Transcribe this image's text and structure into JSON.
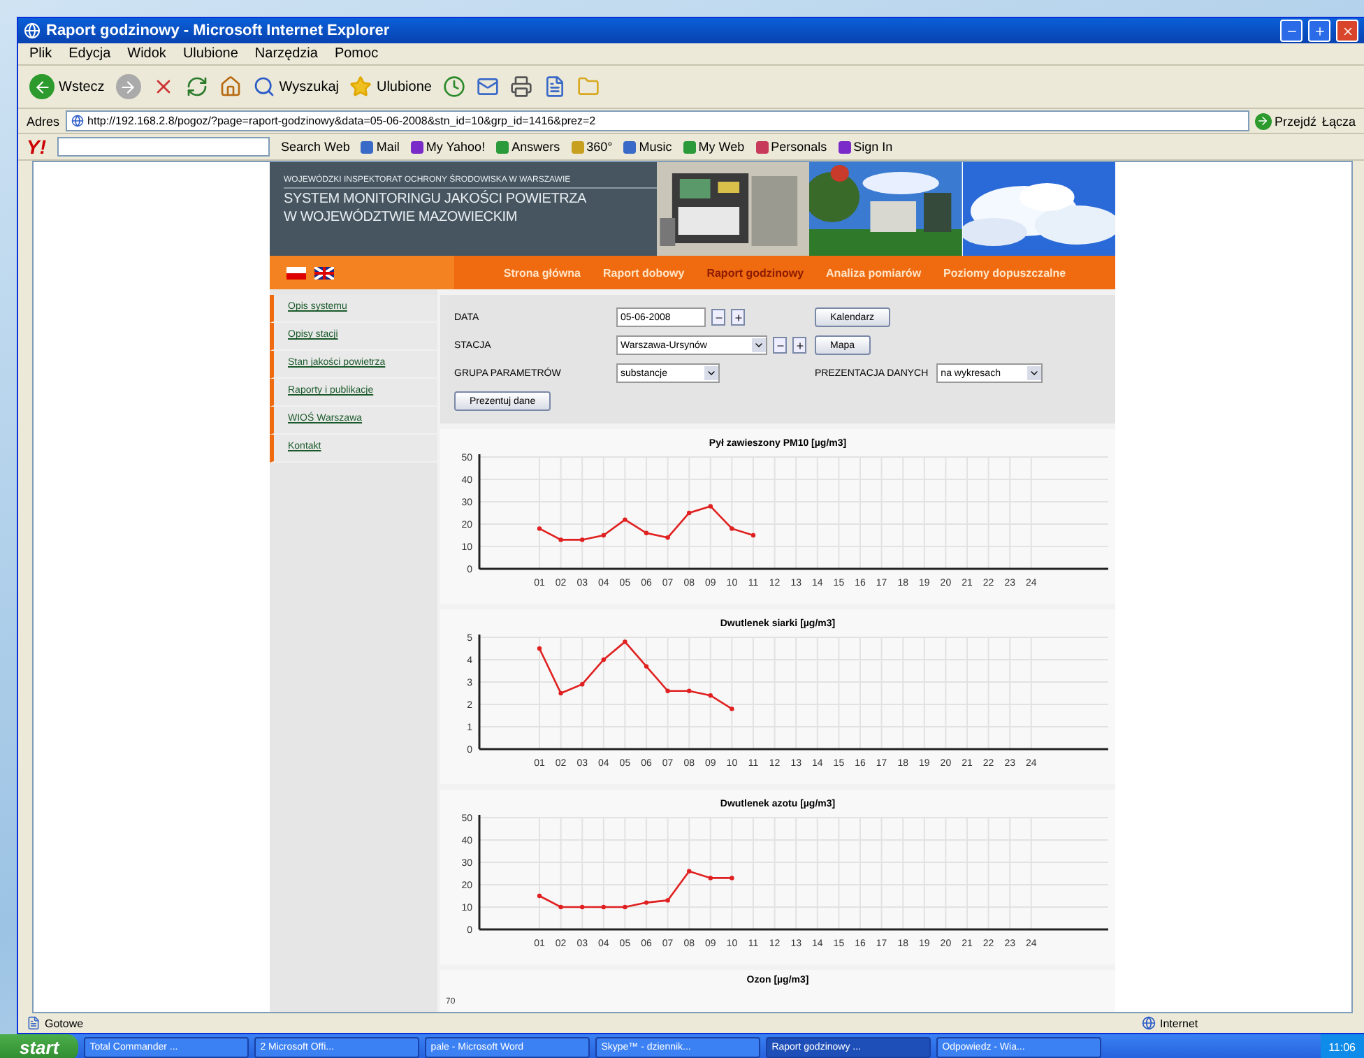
{
  "window": {
    "title": "Raport godzinowy - Microsoft Internet Explorer"
  },
  "menu": [
    "Plik",
    "Edycja",
    "Widok",
    "Ulubione",
    "Narzędzia",
    "Pomoc"
  ],
  "toolbar": {
    "back": "Wstecz",
    "search": "Wyszukaj",
    "favorites": "Ulubione"
  },
  "address_bar": {
    "label": "Adres",
    "url": "http://192.168.2.8/pogoz/?page=raport-godzinowy&data=05-06-2008&stn_id=10&grp_id=1416&prez=2",
    "go": "Przejdź",
    "links": "Łącza"
  },
  "yahoo_bar": {
    "logo": "Y!",
    "search_button": "Search Web",
    "items": [
      "Mail",
      "My Yahoo!",
      "Answers",
      "360°",
      "Music",
      "My Web",
      "Personals",
      "Sign In"
    ]
  },
  "site": {
    "header": {
      "org": "WOJEWÓDZKI INSPEKTORAT OCHRONY ŚRODOWISKA W WARSZAWIE",
      "title_lines": [
        "SYSTEM MONITORINGU JAKOŚCI POWIETRZA",
        "W WOJEWÓDZTWIE MAZOWIECKIM"
      ]
    },
    "nav": [
      {
        "label": "Strona główna",
        "selected": false
      },
      {
        "label": "Raport dobowy",
        "selected": false
      },
      {
        "label": "Raport godzinowy",
        "selected": true
      },
      {
        "label": "Analiza pomiarów",
        "selected": false
      },
      {
        "label": "Poziomy dopuszczalne",
        "selected": false
      }
    ],
    "sidebar": [
      "Opis systemu",
      "Opisy stacji",
      "Stan jakości powietrza",
      "Raporty i publikacje",
      "WIOŚ Warszawa",
      "Kontakt"
    ],
    "form": {
      "date_label": "DATA",
      "date": "05-06-2008",
      "calendar_button": "Kalendarz",
      "station_label": "STACJA",
      "station": "Warszawa-Ursynów",
      "map_button": "Mapa",
      "group_label": "GRUPA PARAMETRÓW",
      "group": "substancje",
      "presentation_label": "PREZENTACJA DANYCH",
      "presentation": "na wykresach",
      "submit": "Prezentuj dane"
    },
    "charts": [
      {
        "chart_data": {
          "type": "line",
          "title": "Pył zawieszony PM10 [µg/m3]",
          "categories": [
            "01",
            "02",
            "03",
            "04",
            "05",
            "06",
            "07",
            "08",
            "09",
            "10",
            "11",
            "12",
            "13",
            "14",
            "15",
            "16",
            "17",
            "18",
            "19",
            "20",
            "21",
            "22",
            "23",
            "24"
          ],
          "ylim": [
            0,
            50
          ],
          "yticks": [
            0,
            10,
            20,
            30,
            40,
            50
          ],
          "grid": true,
          "series": [
            {
              "color": "#e02020",
              "marker": "circle",
              "values": [
                18,
                13,
                13,
                15,
                22,
                16,
                14,
                25,
                28,
                18,
                15,
                null,
                null,
                null,
                null,
                null,
                null,
                null,
                null,
                null,
                null,
                null,
                null,
                null
              ]
            }
          ]
        }
      },
      {
        "chart_data": {
          "type": "line",
          "title": "Dwutlenek siarki [µg/m3]",
          "categories": [
            "01",
            "02",
            "03",
            "04",
            "05",
            "06",
            "07",
            "08",
            "09",
            "10",
            "11",
            "12",
            "13",
            "14",
            "15",
            "16",
            "17",
            "18",
            "19",
            "20",
            "21",
            "22",
            "23",
            "24"
          ],
          "ylim": [
            0,
            5
          ],
          "yticks": [
            0,
            1,
            2,
            3,
            4,
            5
          ],
          "grid": true,
          "series": [
            {
              "color": "#e02020",
              "marker": "circle",
              "values": [
                4.5,
                2.5,
                2.9,
                4.0,
                4.8,
                3.7,
                2.6,
                2.6,
                2.4,
                1.8,
                null,
                null,
                null,
                null,
                null,
                null,
                null,
                null,
                null,
                null,
                null,
                null,
                null,
                null
              ]
            }
          ]
        }
      },
      {
        "chart_data": {
          "type": "line",
          "title": "Dwutlenek azotu [µg/m3]",
          "categories": [
            "01",
            "02",
            "03",
            "04",
            "05",
            "06",
            "07",
            "08",
            "09",
            "10",
            "11",
            "12",
            "13",
            "14",
            "15",
            "16",
            "17",
            "18",
            "19",
            "20",
            "21",
            "22",
            "23",
            "24"
          ],
          "ylim": [
            0,
            50
          ],
          "yticks": [
            0,
            10,
            20,
            30,
            40,
            50
          ],
          "grid": true,
          "series": [
            {
              "color": "#e02020",
              "marker": "circle",
              "values": [
                15,
                10,
                10,
                10,
                10,
                12,
                13,
                26,
                23,
                23,
                null,
                null,
                null,
                null,
                null,
                null,
                null,
                null,
                null,
                null,
                null,
                null,
                null,
                null
              ]
            }
          ]
        }
      }
    ],
    "cut_chart": {
      "title": "Ozon [µg/m3]",
      "top_tick": "70"
    }
  },
  "status_bar": {
    "text": "Gotowe",
    "zone": "Internet"
  },
  "taskbar": {
    "start": "start",
    "tasks": [
      {
        "label": "Total Commander ...",
        "selected": false
      },
      {
        "label": "2 Microsoft Offi...",
        "selected": false
      },
      {
        "label": "pale - Microsoft Word",
        "selected": false
      },
      {
        "label": "Skype™ - dziennik...",
        "selected": false
      },
      {
        "label": "Raport godzinowy ...",
        "selected": true
      },
      {
        "label": "Odpowiedz - Wia...",
        "selected": false
      }
    ],
    "clock": "11:06"
  }
}
